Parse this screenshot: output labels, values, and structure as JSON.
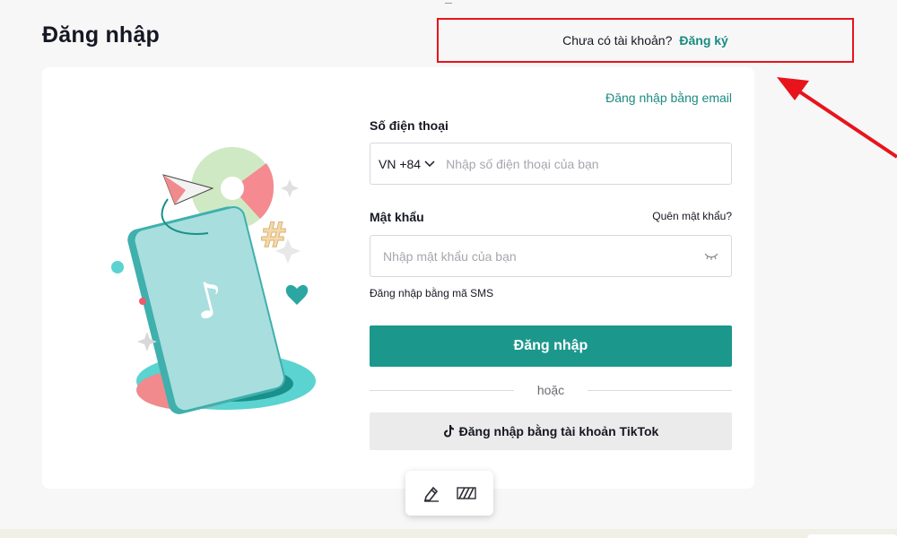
{
  "page": {
    "title": "Đăng nhập"
  },
  "signup": {
    "question": "Chưa có tài khoản?",
    "link": "Đăng ký"
  },
  "form": {
    "email_login_link": "Đăng nhập bằng email",
    "phone_label": "Số điện thoại",
    "country_code": "VN +84",
    "phone_placeholder": "Nhập số điện thoại của bạn",
    "password_label": "Mật khẩu",
    "forgot_password": "Quên mật khẩu?",
    "password_placeholder": "Nhập mật khẩu của bạn",
    "sms_login_link": "Đăng nhập bằng mã SMS",
    "login_button": "Đăng nhập",
    "divider_text": "hoặc",
    "tiktok_button": "Đăng nhập bằng tài khoản TikTok"
  },
  "colors": {
    "accent": "#1c978c",
    "link": "#1b8b80",
    "highlight": "#e8141b"
  },
  "icons": {
    "chevron": "chevron-down-icon",
    "eye": "eye-closed-icon",
    "tiktok": "tiktok-logo-icon",
    "tool1": "pen-edit-icon",
    "tool2": "pattern-icon"
  }
}
